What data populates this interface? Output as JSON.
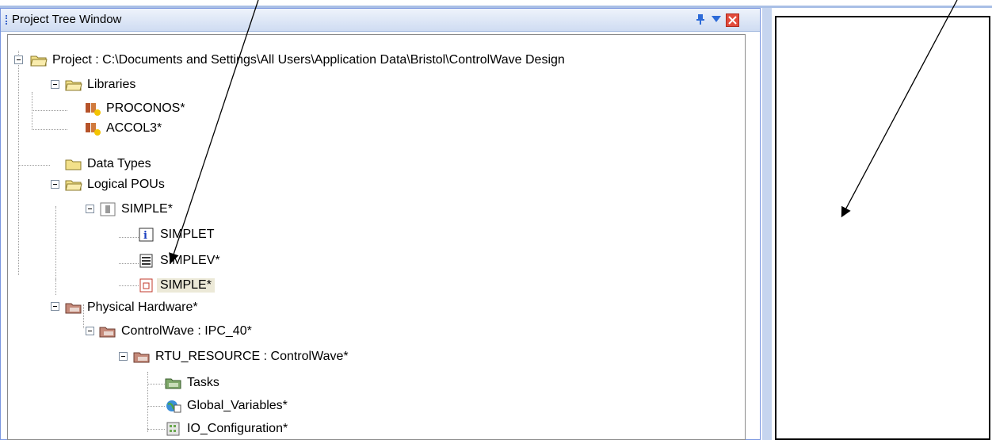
{
  "panel": {
    "title": "Project Tree Window"
  },
  "tree": [
    {
      "label": "Project : C:\\Documents and Settings\\All Users\\Application Data\\Bristol\\ControlWave Design",
      "icon": "folder-open-icon"
    },
    {
      "label": "Libraries",
      "icon": "folder-open-icon"
    },
    {
      "label": "PROCONOS*",
      "icon": "library-book-icon"
    },
    {
      "label": "ACCOL3*",
      "icon": "library-book-icon"
    },
    {
      "label": "Data Types",
      "icon": "folder-icon"
    },
    {
      "label": "Logical POUs",
      "icon": "folder-open-icon"
    },
    {
      "label": "SIMPLE*",
      "icon": "program-icon"
    },
    {
      "label": "SIMPLET",
      "icon": "info-icon"
    },
    {
      "label": "SIMPLEV*",
      "icon": "variables-sheet-icon"
    },
    {
      "label": "SIMPLE*",
      "icon": "code-worksheet-icon"
    },
    {
      "label": "Physical Hardware*",
      "icon": "hardware-folder-icon"
    },
    {
      "label": "ControlWave : IPC_40*",
      "icon": "hardware-folder-icon"
    },
    {
      "label": "RTU_RESOURCE : ControlWave*",
      "icon": "hardware-folder-icon"
    },
    {
      "label": "Tasks",
      "icon": "tasks-folder-icon"
    },
    {
      "label": "Global_Variables*",
      "icon": "globe-sheet-icon"
    },
    {
      "label": "IO_Configuration*",
      "icon": "io-config-icon"
    }
  ],
  "colors": {
    "titlebar": "#cfdcf2",
    "accent": "#3d66c9",
    "close": "#e24b3c",
    "selection": "#ece9d8"
  }
}
